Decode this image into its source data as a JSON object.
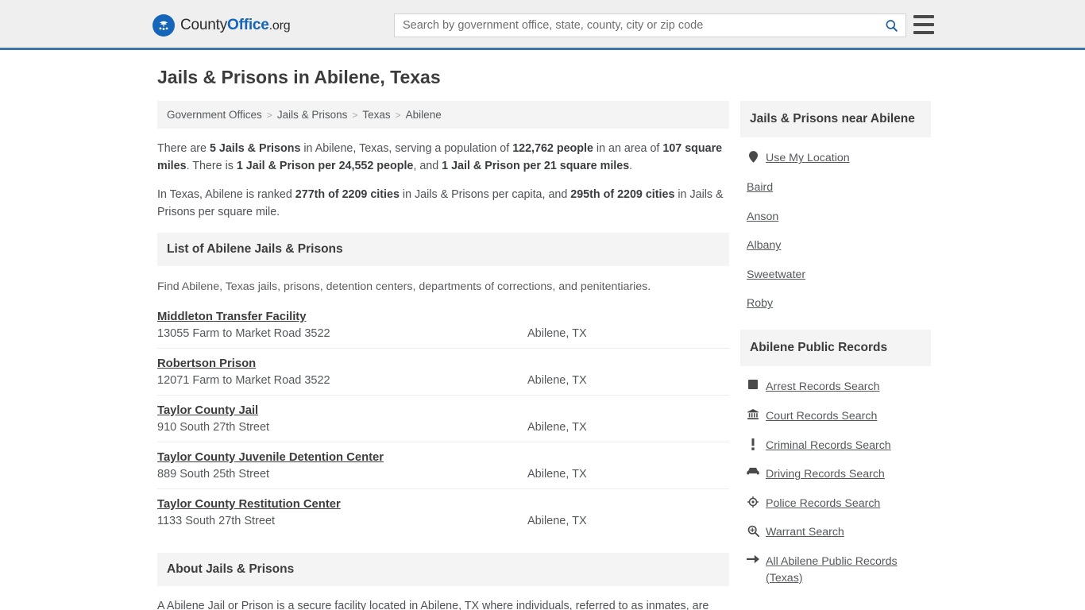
{
  "header": {
    "logo": {
      "icon": "eagle-seal-icon",
      "text_county": "County",
      "text_office": "Office",
      "text_org": ".org"
    },
    "search": {
      "placeholder": "Search by government office, state, county, city or zip code",
      "value": "",
      "button_icon": "search-icon"
    },
    "menu_icon": "hamburger-menu-icon",
    "accent_color": "#3b76a8"
  },
  "page": {
    "title": "Jails & Prisons in Abilene, Texas"
  },
  "breadcrumb": {
    "items": [
      {
        "label": "Government Offices"
      },
      {
        "label": "Jails & Prisons"
      },
      {
        "label": "Texas"
      },
      {
        "label": "Abilene"
      }
    ],
    "separator": ">"
  },
  "intro": {
    "paragraph1": {
      "p1": "There are ",
      "b1": "5 Jails & Prisons",
      "p2": " in Abilene, Texas, serving a population of ",
      "b2": "122,762 people",
      "p3": " in an area of ",
      "b3": "107 square miles",
      "p4": ". There is ",
      "b4": "1 Jail & Prison per 24,552 people",
      "p5": ", and ",
      "b5": "1 Jail & Prison per 21 square miles",
      "p6": "."
    },
    "paragraph2": {
      "p1": "In Texas, Abilene is ranked ",
      "b1": "277th of 2209 cities",
      "p2": " in Jails & Prisons per capita, and ",
      "b2": "295th of 2209 cities",
      "p3": " in Jails & Prisons per square mile."
    }
  },
  "list_section": {
    "heading": "List of Abilene Jails & Prisons",
    "subtext": "Find Abilene, Texas jails, prisons, detention centers, departments of corrections, and penitentiaries.",
    "items": [
      {
        "name": "Middleton Transfer Facility",
        "address": "13055 Farm to Market Road 3522",
        "city": "Abilene, TX"
      },
      {
        "name": "Robertson Prison",
        "address": "12071 Farm to Market Road 3522",
        "city": "Abilene, TX"
      },
      {
        "name": "Taylor County Jail",
        "address": "910 South 27th Street",
        "city": "Abilene, TX"
      },
      {
        "name": "Taylor County Juvenile Detention Center",
        "address": "889 South 25th Street",
        "city": "Abilene, TX"
      },
      {
        "name": "Taylor County Restitution Center",
        "address": "1133 South 27th Street",
        "city": "Abilene, TX"
      }
    ]
  },
  "about_section": {
    "heading": "About Jails & Prisons",
    "text": "A Abilene Jail or Prison is a secure facility located in Abilene, TX where individuals, referred to as inmates, are"
  },
  "sidebar": {
    "near_box": {
      "heading": "Jails & Prisons near Abilene",
      "items": [
        {
          "label": "Use My Location",
          "icon": "map-pin-icon"
        },
        {
          "label": "Baird",
          "icon": ""
        },
        {
          "label": "Anson",
          "icon": ""
        },
        {
          "label": "Albany",
          "icon": ""
        },
        {
          "label": "Sweetwater",
          "icon": ""
        },
        {
          "label": "Roby",
          "icon": ""
        }
      ]
    },
    "records_box": {
      "heading": "Abilene Public Records",
      "items": [
        {
          "label": "Arrest Records Search",
          "icon": "fingerprint-icon"
        },
        {
          "label": "Court Records Search",
          "icon": "courthouse-icon"
        },
        {
          "label": "Criminal Records Search",
          "icon": "exclamation-icon"
        },
        {
          "label": "Driving Records Search",
          "icon": "car-icon"
        },
        {
          "label": "Police Records Search",
          "icon": "police-badge-icon"
        },
        {
          "label": "Warrant Search",
          "icon": "magnifier-plus-icon"
        },
        {
          "label": "All Abilene Public Records (Texas)",
          "icon": "arrow-right-icon"
        }
      ]
    }
  }
}
